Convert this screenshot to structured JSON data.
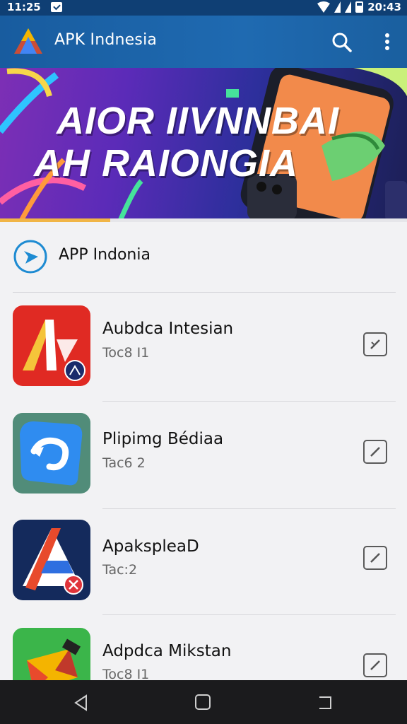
{
  "status_bar": {
    "time_left": "11:25",
    "time_right": "20:43"
  },
  "app_bar": {
    "title": "APK Indnesia",
    "icons": [
      "app-logo-icon",
      "search-icon",
      "more-vert-icon"
    ]
  },
  "banner": {
    "line1": "AIOR IIVNNBAI",
    "line2": "AH RAIONGIA",
    "progress": 0.27
  },
  "section": {
    "title": "APP Indonia",
    "icon": "play-circle-icon"
  },
  "apps": [
    {
      "name": "Aubdca Intesian",
      "subtitle": "Toc8 I1",
      "action_icon": "edit-icon"
    },
    {
      "name": "Plipimg Bédiaa",
      "subtitle": "Tac6 2",
      "action_icon": "edit-icon"
    },
    {
      "name": "ApakspleaD",
      "subtitle": "Tac:2",
      "action_icon": "edit-icon"
    },
    {
      "name": "Adpdca Mikstan",
      "subtitle": "Toc8 I1",
      "action_icon": "edit-icon"
    }
  ],
  "nav_bar": {
    "icons": [
      "back-icon",
      "home-icon",
      "recents-icon"
    ]
  },
  "colors": {
    "app_bar": "#1f6ab1",
    "status_bar": "#0f3f74",
    "accent": "#f1b546",
    "background": "#f2f2f4"
  }
}
